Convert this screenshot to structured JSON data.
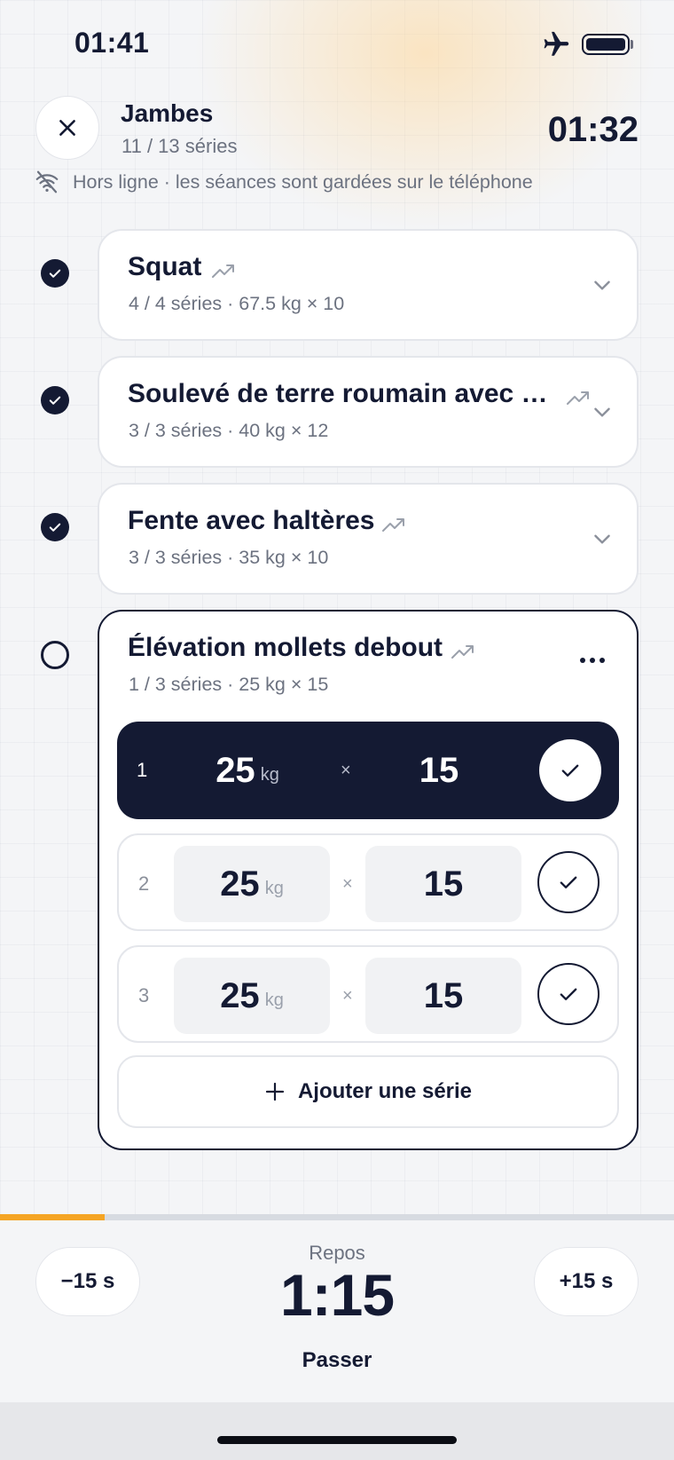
{
  "status_bar": {
    "time": "01:41"
  },
  "header": {
    "title": "Jambes",
    "sets_progress": "11 / 13 séries",
    "elapsed": "01:32",
    "offline_notice": "Hors ligne · les séances sont gardées sur le téléphone"
  },
  "exercises": [
    {
      "name": "Squat",
      "detail": "4 / 4 séries · 67.5 kg × 10",
      "done": true
    },
    {
      "name": "Soulevé de terre roumain avec h...",
      "detail": "3 / 3 séries · 40 kg × 12",
      "done": true
    },
    {
      "name": "Fente avec haltères",
      "detail": "3 / 3 séries · 35 kg × 10",
      "done": true
    },
    {
      "name": "Élévation mollets debout",
      "detail": "1 / 3 séries · 25 kg × 15",
      "done": false,
      "times_symbol": "×",
      "sets": [
        {
          "num": "1",
          "weight": "25",
          "unit": "kg",
          "reps": "15",
          "state": "current"
        },
        {
          "num": "2",
          "weight": "25",
          "unit": "kg",
          "reps": "15",
          "state": "pending"
        },
        {
          "num": "3",
          "weight": "25",
          "unit": "kg",
          "reps": "15",
          "state": "pending"
        }
      ],
      "add_set_label": "Ajouter une série"
    }
  ],
  "rest": {
    "label": "Repos",
    "time": "1:15",
    "minus_label": "−15 s",
    "plus_label": "+15 s",
    "skip_label": "Passer",
    "progress": 0.155
  },
  "colors": {
    "primary": "#141a33",
    "accent": "#f5a524",
    "muted": "#6c7280"
  },
  "icons": [
    "close-icon",
    "airplane-icon",
    "battery-icon",
    "wifi-off-icon",
    "check-icon",
    "trend-up-icon",
    "chevron-down-icon",
    "more-icon",
    "plus-icon"
  ]
}
